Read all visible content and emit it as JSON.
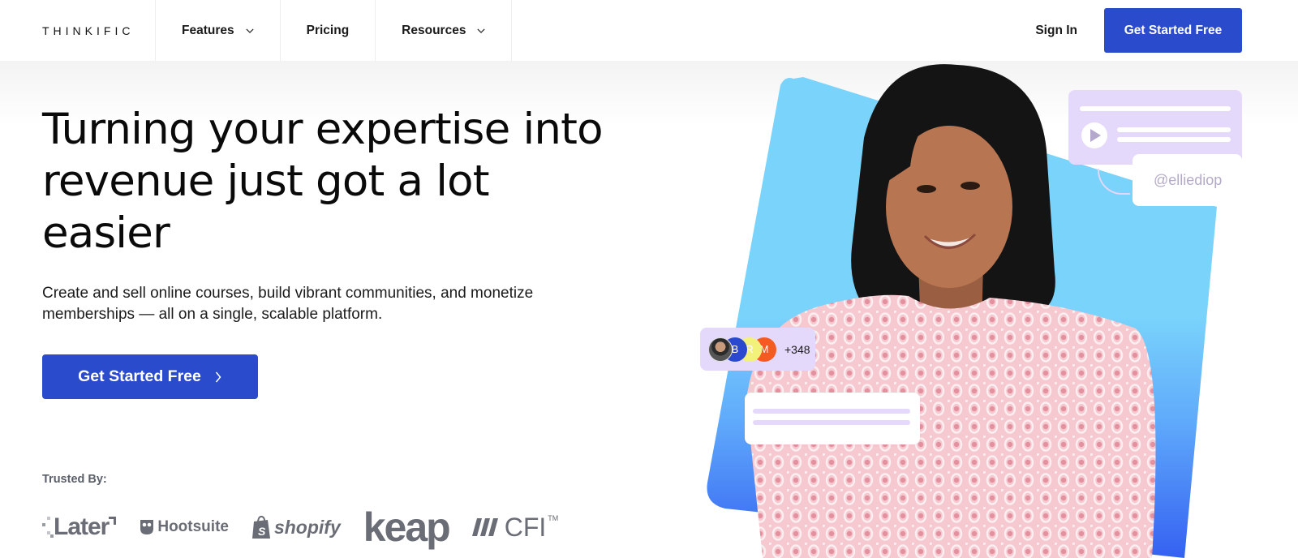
{
  "nav": {
    "logo": "THINKIFIC",
    "items": [
      {
        "label": "Features",
        "has_dropdown": true
      },
      {
        "label": "Pricing",
        "has_dropdown": false
      },
      {
        "label": "Resources",
        "has_dropdown": true
      }
    ],
    "sign_in": "Sign In",
    "cta": "Get Started Free"
  },
  "hero": {
    "headline_lines": [
      "Turning your expertise into",
      "revenue just got a lot",
      "easier"
    ],
    "subhead": "Create and sell online courses, build vibrant communities, and monetize memberships — all on a single, scalable platform.",
    "cta": "Get Started Free",
    "cta_icon": "chevron-right-icon"
  },
  "trusted": {
    "label": "Trusted By:",
    "logos": [
      "Later",
      "Hootsuite",
      "shopify",
      "keap",
      "CFI"
    ],
    "trademark": "TM"
  },
  "visual": {
    "handle": "@elliediop",
    "members": {
      "avatars": [
        "",
        "B",
        "R",
        "M"
      ],
      "count": "+348"
    }
  },
  "colors": {
    "brand_blue": "#2a4bcc",
    "lavender": "#e5d9fb",
    "sky_blue": "#79d3fb",
    "deep_blue": "#3a62f0"
  }
}
